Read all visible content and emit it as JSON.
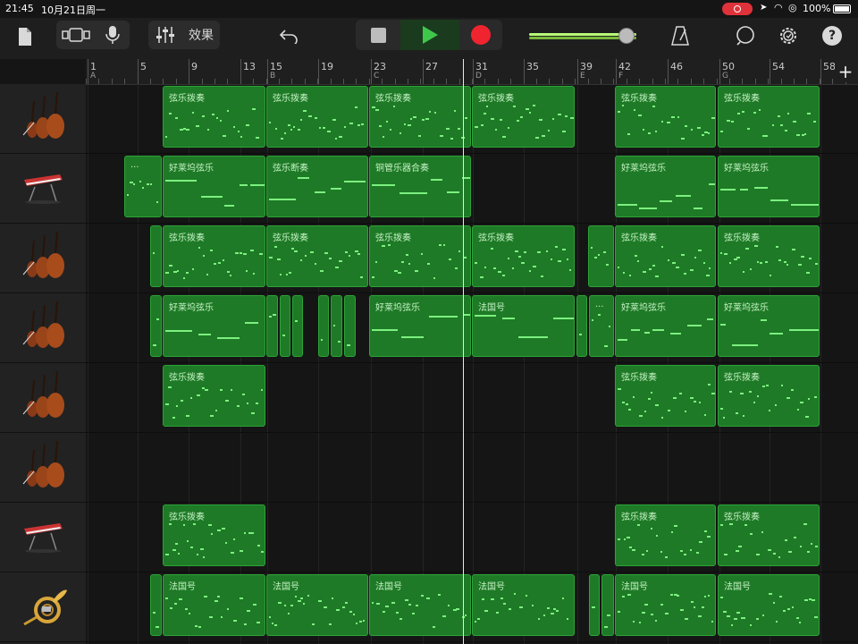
{
  "status": {
    "time": "21:45",
    "date": "10月21日周一",
    "battery": "100%"
  },
  "toolbar": {
    "effects_label": "效果"
  },
  "ruler": {
    "bars": [
      {
        "num": "1",
        "sec": "A"
      },
      {
        "num": "5",
        "sec": ""
      },
      {
        "num": "9",
        "sec": ""
      },
      {
        "num": "13",
        "sec": ""
      },
      {
        "num": "15",
        "sec": "B"
      },
      {
        "num": "19",
        "sec": ""
      },
      {
        "num": "23",
        "sec": "C"
      },
      {
        "num": "27",
        "sec": ""
      },
      {
        "num": "31",
        "sec": "D"
      },
      {
        "num": "35",
        "sec": ""
      },
      {
        "num": "39",
        "sec": "E"
      },
      {
        "num": "42",
        "sec": "F"
      },
      {
        "num": "46",
        "sec": ""
      },
      {
        "num": "50",
        "sec": "G"
      },
      {
        "num": "54",
        "sec": ""
      },
      {
        "num": "58",
        "sec": ""
      }
    ],
    "add_label": "+"
  },
  "tracks": [
    {
      "instrument": "strings-icon",
      "regions": [
        {
          "label": "弦乐拨奏"
        },
        {
          "label": "弦乐拨奏"
        },
        {
          "label": "弦乐拨奏"
        },
        {
          "label": "弦乐拨奏"
        },
        {
          "label": "弦乐拨奏"
        },
        {
          "label": "弦乐拨奏"
        }
      ]
    },
    {
      "instrument": "keyboard-icon",
      "regions": [
        {
          "label": "..."
        },
        {
          "label": "好莱坞弦乐"
        },
        {
          "label": "弦乐断奏"
        },
        {
          "label": "铜管乐器合奏"
        },
        {
          "label": "好莱坞弦乐"
        },
        {
          "label": "好莱坞弦乐"
        }
      ]
    },
    {
      "instrument": "strings-icon",
      "regions": [
        {
          "label": ""
        },
        {
          "label": "弦乐拨奏"
        },
        {
          "label": "弦乐拨奏"
        },
        {
          "label": "弦乐拨奏"
        },
        {
          "label": "弦乐拨奏"
        },
        {
          "label": ""
        },
        {
          "label": "弦乐拨奏"
        },
        {
          "label": "弦乐拨奏"
        }
      ]
    },
    {
      "instrument": "strings-icon",
      "regions": [
        {
          "label": ""
        },
        {
          "label": "好莱坞弦乐"
        },
        {
          "label": ""
        },
        {
          "label": ""
        },
        {
          "label": ""
        },
        {
          "label": ""
        },
        {
          "label": ""
        },
        {
          "label": ""
        },
        {
          "label": "好莱坞弦乐"
        },
        {
          "label": "法国号"
        },
        {
          "label": ""
        },
        {
          "label": "..."
        },
        {
          "label": "好莱坞弦乐"
        },
        {
          "label": "好莱坞弦乐"
        }
      ]
    },
    {
      "instrument": "strings-icon",
      "regions": [
        {
          "label": "弦乐拨奏"
        },
        {
          "label": "弦乐拨奏"
        },
        {
          "label": "弦乐拨奏"
        }
      ]
    },
    {
      "instrument": "strings-icon",
      "regions": []
    },
    {
      "instrument": "keyboard-icon",
      "regions": [
        {
          "label": "弦乐拨奏"
        },
        {
          "label": "弦乐拨奏"
        },
        {
          "label": "弦乐拨奏"
        }
      ]
    },
    {
      "instrument": "french-horn-icon",
      "regions": [
        {
          "label": ""
        },
        {
          "label": "法国号"
        },
        {
          "label": "法国号"
        },
        {
          "label": "法国号"
        },
        {
          "label": "法国号"
        },
        {
          "label": ""
        },
        {
          "label": ""
        },
        {
          "label": "法国号"
        },
        {
          "label": "法国号"
        }
      ]
    }
  ]
}
